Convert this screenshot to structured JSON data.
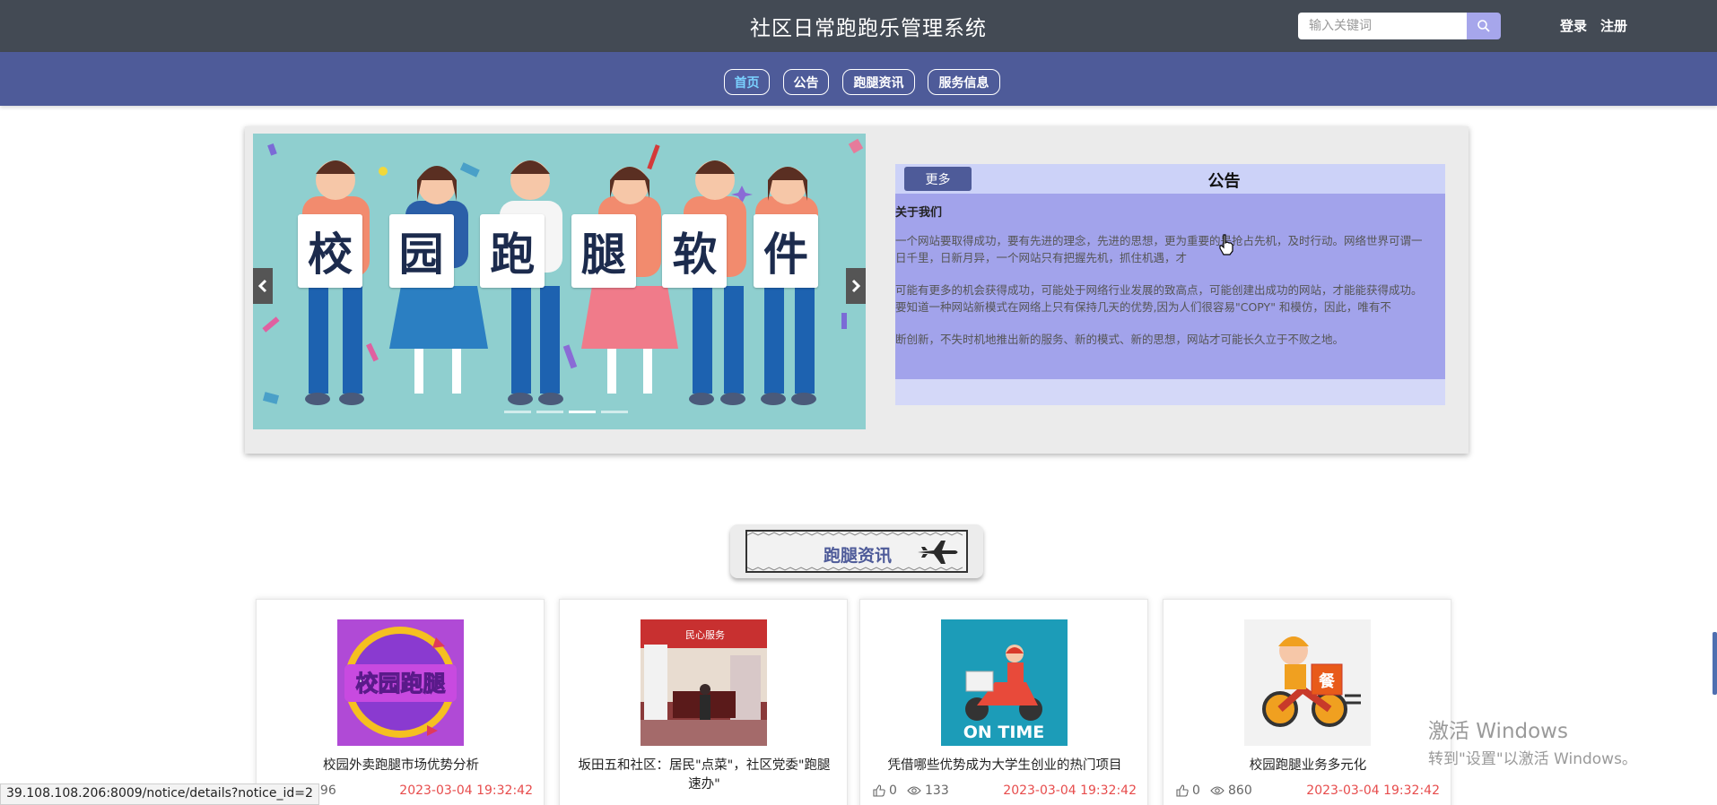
{
  "header": {
    "title": "社区日常跑跑乐管理系统",
    "search_placeholder": "输入关键词",
    "login": "登录",
    "register": "注册"
  },
  "nav": {
    "items": [
      {
        "label": "首页",
        "active": true
      },
      {
        "label": "公告",
        "active": false
      },
      {
        "label": "跑腿资讯",
        "active": false
      },
      {
        "label": "服务信息",
        "active": false
      }
    ]
  },
  "carousel": {
    "banner_text": [
      "校",
      "园",
      "跑",
      "腿",
      "软",
      "件"
    ],
    "slide_count": 4,
    "active_slide": 3
  },
  "notice": {
    "more_label": "更多",
    "title": "公告",
    "subtitle": "关于我们",
    "paragraphs": [
      "一个网站要取得成功，要有先进的理念，先进的思想，更为重要的是抢占先机，及时行动。网络世界可谓一日千里，日新月异，一个网站只有把握先机，抓住机遇，才",
      "可能有更多的机会获得成功，可能处于网络行业发展的致高点，可能创建出成功的网站，才能能获得成功。要知道一种网站新模式在网络上只有保持几天的优势,因为人们很容易\"COPY\" 和模仿，因此，唯有不",
      "断创新，不失时机地推出新的服务、新的模式、新的思想，网站才可能长久立于不败之地。"
    ]
  },
  "section": {
    "title": "跑腿资讯"
  },
  "cards": [
    {
      "title": "校园外卖跑腿市场优势分析",
      "likes": "",
      "views": "296",
      "date": "2023-03-04 19:32:42",
      "image_text": "校园跑腿"
    },
    {
      "title": "坂田五和社区：居民\"点菜\"，社区党委\"跑腿速办\"",
      "likes": "",
      "views": "",
      "date": "",
      "image_text": "民心服务"
    },
    {
      "title": "凭借哪些优势成为大学生创业的热门项目",
      "likes": "0",
      "views": "133",
      "date": "2023-03-04 19:32:42",
      "image_text": "ON TIME"
    },
    {
      "title": "校园跑腿业务多元化",
      "likes": "0",
      "views": "860",
      "date": "2023-03-04 19:32:42",
      "image_text": "餐"
    }
  ],
  "status_url": "39.108.108.206:8009/notice/details?notice_id=2",
  "watermark": {
    "line1": "激活 Windows",
    "line2": "转到\"设置\"以激活 Windows。"
  },
  "colors": {
    "topbar": "#434a54",
    "navbar": "#4e5b99",
    "notice_body": "#a2a3eb",
    "date": "#e74c4c"
  }
}
